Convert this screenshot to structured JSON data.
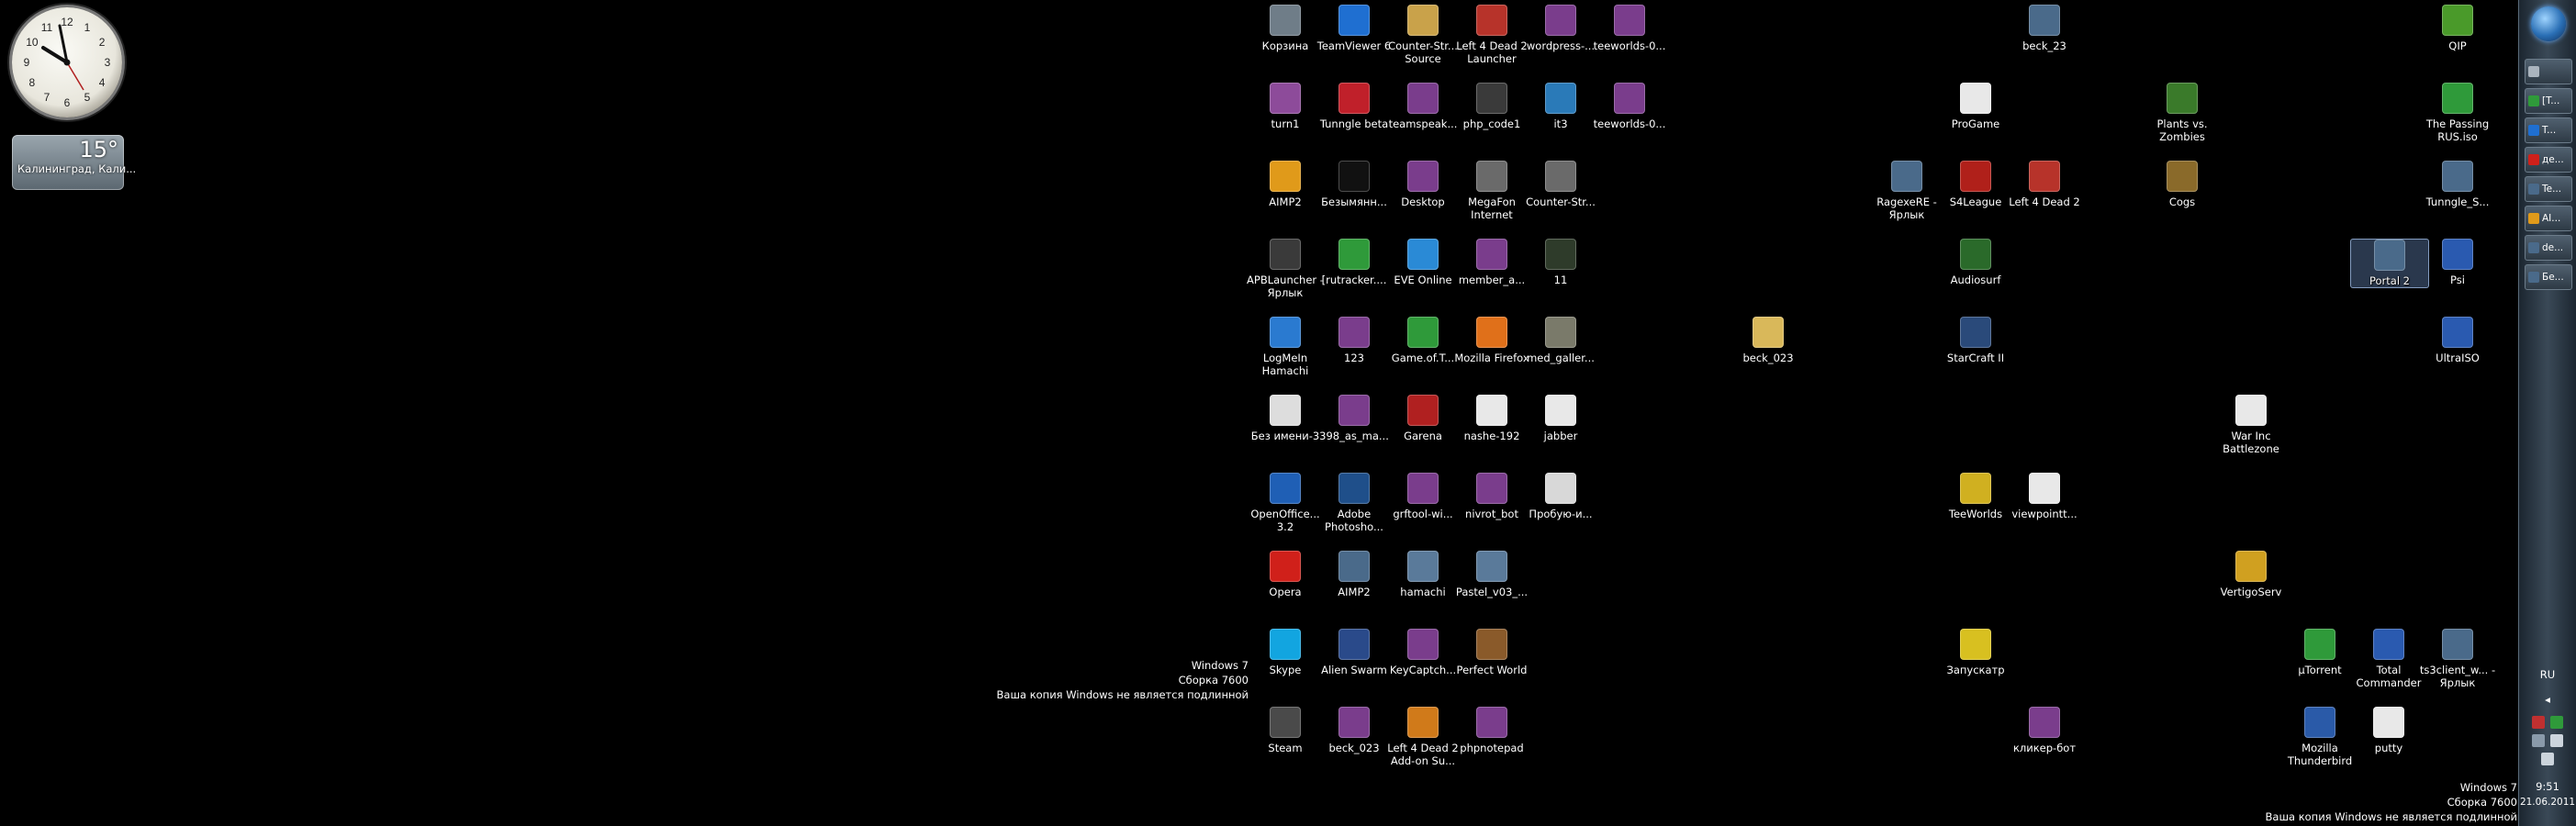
{
  "gadgets": {
    "clock": {
      "hour_marks": [
        "12",
        "1",
        "2",
        "3",
        "4",
        "5",
        "6",
        "7",
        "8",
        "9",
        "10",
        "11"
      ]
    },
    "weather": {
      "temperature": "15°",
      "city": "Калининград, Кали..."
    }
  },
  "watermark_center": {
    "line1": "Windows 7",
    "line2": "Сборка 7600",
    "line3": "Ваша копия Windows не является подлинной"
  },
  "watermark_corner": {
    "line1": "Windows 7",
    "line2": "Сборка 7600",
    "line3": "Ваша копия Windows не является подлинной"
  },
  "desktop_icons": [
    {
      "label": "Корзина",
      "icon": "recycle-bin-icon",
      "color": "#6f7d88"
    },
    {
      "label": "TeamViewer 6",
      "icon": "teamviewer-icon",
      "color": "#1f6fd1"
    },
    {
      "label": "Counter-Str... Source",
      "icon": "counter-strike-icon",
      "color": "#c9a24a"
    },
    {
      "label": "Left 4 Dead 2 Launcher",
      "icon": "left4dead-icon",
      "color": "#b7332a"
    },
    {
      "label": "wordpress-...",
      "icon": "winrar-archive-icon",
      "color": "#7a3d8c"
    },
    {
      "label": "teeworlds-0...",
      "icon": "winrar-archive-icon",
      "color": "#7a3d8c"
    },
    {
      "label": "turn1",
      "icon": "image-file-icon",
      "color": "#8d4b9a"
    },
    {
      "label": "Tunngle beta",
      "icon": "tunngle-icon",
      "color": "#c0202a"
    },
    {
      "label": "teamspeak...",
      "icon": "winrar-archive-icon",
      "color": "#7a3d8c"
    },
    {
      "label": "php_code1",
      "icon": "image-file-icon",
      "color": "#3a3a3a"
    },
    {
      "label": "it3",
      "icon": "image-file-icon",
      "color": "#2a7ab8"
    },
    {
      "label": "teeworlds-0...",
      "icon": "winrar-archive-icon",
      "color": "#7a3d8c"
    },
    {
      "label": "AIMP2",
      "icon": "aimp-icon",
      "color": "#e09a1a"
    },
    {
      "label": "Безымянн...",
      "icon": "blank-file-icon",
      "color": "#111111"
    },
    {
      "label": "Desktop",
      "icon": "winrar-archive-icon",
      "color": "#7a3d8c"
    },
    {
      "label": "MegaFon Internet",
      "icon": "megafon-icon",
      "color": "#6a6a6a"
    },
    {
      "label": "Counter-Str...",
      "icon": "counter-strike-icon",
      "color": "#6a6a6a"
    },
    {
      "label": "APBLauncher - Ярлык",
      "icon": "apb-launcher-icon",
      "color": "#3a3a3a"
    },
    {
      "label": "[rutracker....",
      "icon": "utorrent-icon",
      "color": "#2f9a3a"
    },
    {
      "label": "EVE Online",
      "icon": "eve-online-icon",
      "color": "#2a8ad6"
    },
    {
      "label": "member_a...",
      "icon": "winrar-archive-icon",
      "color": "#7a3d8c"
    },
    {
      "label": "11",
      "icon": "image-file-icon",
      "color": "#2e3b2a"
    },
    {
      "label": "LogMeIn Hamachi",
      "icon": "hamachi-icon",
      "color": "#2a7ad0"
    },
    {
      "label": "123",
      "icon": "winrar-archive-icon",
      "color": "#7a3d8c"
    },
    {
      "label": "Game.of.T...",
      "icon": "utorrent-icon",
      "color": "#2f9a3a"
    },
    {
      "label": "Mozilla Firefox",
      "icon": "firefox-icon",
      "color": "#e0701a"
    },
    {
      "label": "med_galler...",
      "icon": "image-file-icon",
      "color": "#7a7a6a"
    },
    {
      "label": "Без имени-3",
      "icon": "blank-file-icon",
      "color": "#dddddd"
    },
    {
      "label": "398_as_ma...",
      "icon": "winrar-archive-icon",
      "color": "#7a3d8c"
    },
    {
      "label": "Garena",
      "icon": "garena-icon",
      "color": "#b02020"
    },
    {
      "label": "nashe-192",
      "icon": "document-icon",
      "color": "#e8e8e8"
    },
    {
      "label": "jabber",
      "icon": "document-icon",
      "color": "#e8e8e8"
    },
    {
      "label": "OpenOffice... 3.2",
      "icon": "openoffice-icon",
      "color": "#1f5fb5"
    },
    {
      "label": "Adobe Photosho...",
      "icon": "photoshop-icon",
      "color": "#1f4f8a"
    },
    {
      "label": "grftool-wi...",
      "icon": "winrar-archive-icon",
      "color": "#7a3d8c"
    },
    {
      "label": "nivrot_bot",
      "icon": "winrar-archive-icon",
      "color": "#7a3d8c"
    },
    {
      "label": "Пробую-и...",
      "icon": "image-file-icon",
      "color": "#d8d8d8"
    },
    {
      "label": "Opera",
      "icon": "opera-icon",
      "color": "#d0201a"
    },
    {
      "label": "AIMP2",
      "icon": "shortcut-icon",
      "color": "#4a6a8a"
    },
    {
      "label": "hamachi",
      "icon": "shortcut-icon",
      "color": "#5a7a9a"
    },
    {
      "label": "Pastel_v03_...",
      "icon": "shortcut-icon",
      "color": "#5a7a9a"
    },
    {
      "label": "Skype",
      "icon": "skype-icon",
      "color": "#12a5e0"
    },
    {
      "label": "Alien Swarm",
      "icon": "alien-swarm-icon",
      "color": "#2a4a8a"
    },
    {
      "label": "KeyCaptch...",
      "icon": "winrar-archive-icon",
      "color": "#7a3d8c"
    },
    {
      "label": "Perfect World",
      "icon": "perfect-world-icon",
      "color": "#8a5a2a"
    },
    {
      "label": "Steam",
      "icon": "steam-icon",
      "color": "#4a4a4a"
    },
    {
      "label": "beck_023",
      "icon": "winrar-archive-icon",
      "color": "#7a3d8c"
    },
    {
      "label": "Left 4 Dead 2 Add-on Su...",
      "icon": "left4dead-icon",
      "color": "#d07a1a"
    },
    {
      "label": "phpnotepad",
      "icon": "winrar-archive-icon",
      "color": "#7a3d8c"
    },
    {
      "label": "beck_023",
      "icon": "folder-icon",
      "color": "#d9b85a"
    },
    {
      "label": "ProGame",
      "icon": "document-icon",
      "color": "#e8e8e8"
    },
    {
      "label": "RagexeRE - Ярлык",
      "icon": "shortcut-icon",
      "color": "#4a6a8a"
    },
    {
      "label": "S4League",
      "icon": "s4league-icon",
      "color": "#b0201a"
    },
    {
      "label": "Audiosurf",
      "icon": "audiosurf-icon",
      "color": "#2a6a2a"
    },
    {
      "label": "StarCraft II",
      "icon": "starcraft-icon",
      "color": "#2a4a7a"
    },
    {
      "label": "TeeWorlds",
      "icon": "teeworlds-icon",
      "color": "#d0b020"
    },
    {
      "label": "viewpointt...",
      "icon": "document-icon",
      "color": "#e8e8e8"
    },
    {
      "label": "Запускатр",
      "icon": "launcher-icon",
      "color": "#d8c020"
    },
    {
      "label": "beck_23",
      "icon": "shortcut-icon",
      "color": "#4a6a8a"
    },
    {
      "label": "Left 4 Dead 2",
      "icon": "left4dead-icon",
      "color": "#b7332a"
    },
    {
      "label": "кликер-бот",
      "icon": "winrar-archive-icon",
      "color": "#7a3d8c"
    },
    {
      "label": "Plants vs. Zombies",
      "icon": "plants-vs-zombies-icon",
      "color": "#3a7a2a"
    },
    {
      "label": "Cogs",
      "icon": "cogs-icon",
      "color": "#8a6a2a"
    },
    {
      "label": "War Inc Battlezone",
      "icon": "document-icon",
      "color": "#e8e8e8"
    },
    {
      "label": "VertigoServ",
      "icon": "shortcut-icon",
      "color": "#d0a020"
    },
    {
      "label": "µTorrent",
      "icon": "utorrent-icon",
      "color": "#2f9a3a"
    },
    {
      "label": "Mozilla Thunderbird",
      "icon": "thunderbird-icon",
      "color": "#2a5aa8"
    },
    {
      "label": "QIP",
      "icon": "qip-icon",
      "color": "#4a9a2a"
    },
    {
      "label": "The Passing RUS.iso",
      "icon": "utorrent-icon",
      "color": "#2f9a3a"
    },
    {
      "label": "Tunngle_S...",
      "icon": "shortcut-icon",
      "color": "#4a6a8a"
    },
    {
      "label": "Portal 2",
      "icon": "shortcut-icon",
      "color": "#4a6a8a"
    },
    {
      "label": "Psi",
      "icon": "psi-icon",
      "color": "#2a5ab0"
    },
    {
      "label": "UltraISO",
      "icon": "ultraiso-icon",
      "color": "#2a5ab0"
    },
    {
      "label": "Total Commander",
      "icon": "total-commander-icon",
      "color": "#2a5ab0"
    },
    {
      "label": "ts3client_w... - Ярлык",
      "icon": "teamspeak-icon",
      "color": "#4a6a8a"
    },
    {
      "label": "putty",
      "icon": "putty-icon",
      "color": "#e8e8e8"
    }
  ],
  "taskbar": {
    "buttons": [
      {
        "label": "",
        "color": "#aab4be"
      },
      {
        "label": "[T...",
        "color": "#2f9a3a"
      },
      {
        "label": "T...",
        "color": "#1f6fd1"
      },
      {
        "label": "де...",
        "color": "#d0201a"
      },
      {
        "label": "Te...",
        "color": "#4a6a8a"
      },
      {
        "label": "AI...",
        "color": "#e09a1a"
      },
      {
        "label": "de...",
        "color": "#4a6a8a"
      },
      {
        "label": "Бе...",
        "color": "#4a6a8a"
      }
    ],
    "language": "RU",
    "time": "9:51",
    "date": "21.06.2011"
  }
}
